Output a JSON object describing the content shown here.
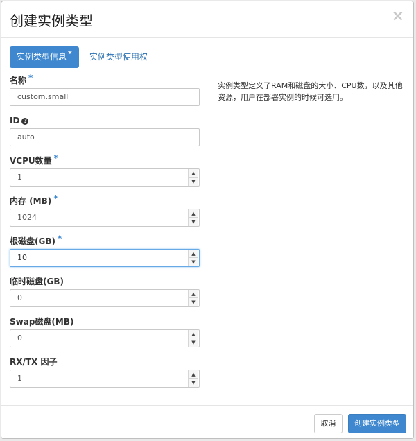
{
  "dialog": {
    "title": "创建实例类型"
  },
  "close_glyph": "×",
  "tabs": {
    "active": {
      "label": "实例类型信息",
      "required_mark": "*"
    },
    "other": {
      "label": "实例类型使用权"
    }
  },
  "description": "实例类型定义了RAM和磁盘的大小、CPU数，以及其他资源，用户在部署实例的时候可选用。",
  "fields": {
    "name": {
      "label": "名称",
      "required_mark": "*",
      "value": "custom.small"
    },
    "id": {
      "label": "ID",
      "help_glyph": "?",
      "value": "auto"
    },
    "vcpu": {
      "label": "VCPU数量",
      "required_mark": "*",
      "value": "1"
    },
    "ram": {
      "label": "内存 (MB)",
      "required_mark": "*",
      "value": "1024"
    },
    "root_disk": {
      "label": "根磁盘(GB)",
      "required_mark": "*",
      "value": "10"
    },
    "ephemeral_disk": {
      "label": "临时磁盘(GB)",
      "value": "0"
    },
    "swap_disk": {
      "label": "Swap磁盘(MB)",
      "value": "0"
    },
    "rxtx": {
      "label": "RX/TX 因子",
      "value": "1"
    }
  },
  "spinner": {
    "up_glyph": "▲",
    "down_glyph": "▼"
  },
  "footer": {
    "cancel_label": "取消",
    "submit_label": "创建实例类型"
  },
  "colors": {
    "primary": "#3f88cf",
    "focus_border": "#66a9e6"
  }
}
